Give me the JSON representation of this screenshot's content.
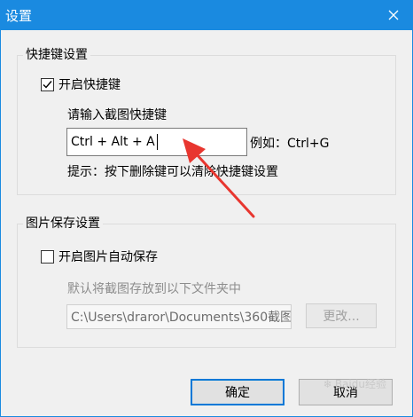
{
  "window": {
    "title": "设置",
    "close_icon": "close-icon"
  },
  "hotkey_group": {
    "legend": "快捷键设置",
    "enable_checkbox": {
      "label": "开启快捷键",
      "checked": true
    },
    "prompt": "请输入截图快捷键",
    "input_value": "Ctrl + Alt + A",
    "example": "例如：Ctrl+G",
    "hint": "提示：按下删除键可以清除快捷键设置"
  },
  "save_group": {
    "legend": "图片保存设置",
    "enable_checkbox": {
      "label": "开启图片自动保存",
      "checked": false
    },
    "prompt": "默认将截图存放到以下文件夹中",
    "path_value": "C:\\Users\\draror\\Documents\\360截图",
    "change_button": "更改..."
  },
  "footer": {
    "ok_button": "确定",
    "cancel_button": "取消"
  },
  "watermark": "Baidu经验",
  "colors": {
    "titlebar": "#1a8ae0",
    "arrow": "#e8362f",
    "default_button_border": "#0078d7"
  }
}
